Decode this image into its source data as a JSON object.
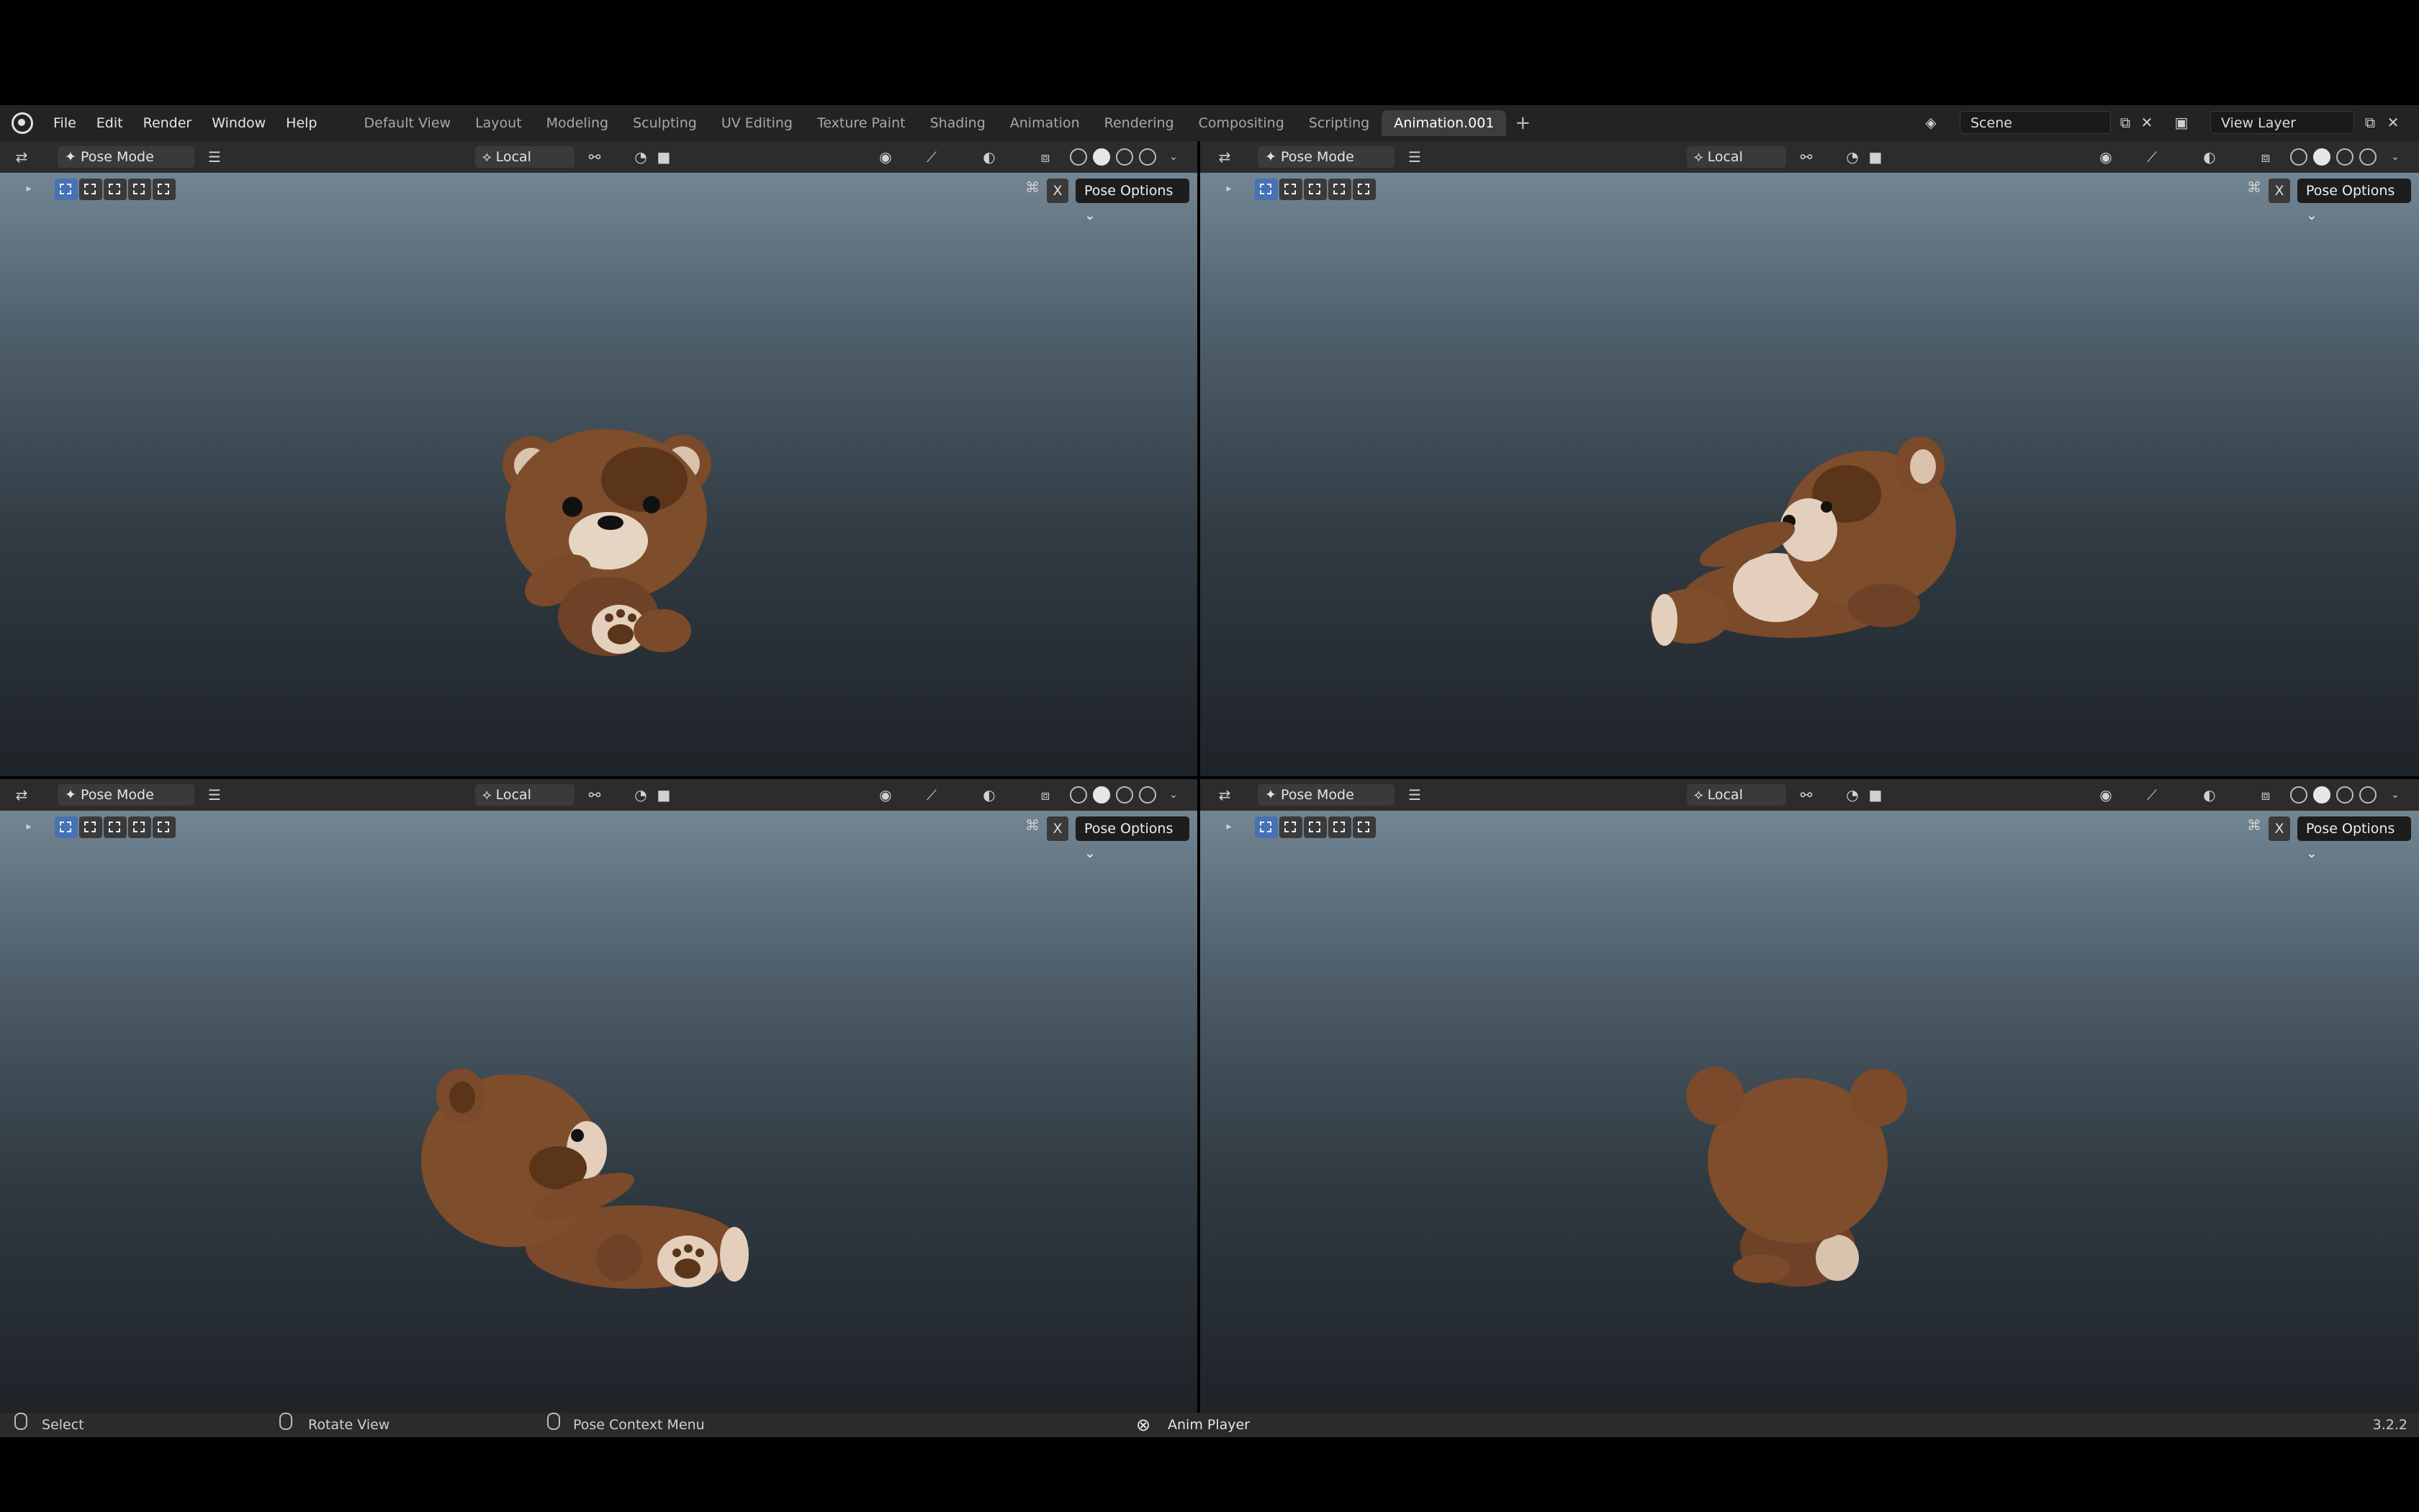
{
  "menu": [
    "File",
    "Edit",
    "Render",
    "Window",
    "Help"
  ],
  "workspaces": [
    "Default View",
    "Layout",
    "Modeling",
    "Sculpting",
    "UV Editing",
    "Texture Paint",
    "Shading",
    "Animation",
    "Rendering",
    "Compositing",
    "Scripting",
    "Animation.001"
  ],
  "active_workspace": "Animation.001",
  "scene": "Scene",
  "view_layer": "View Layer",
  "viewports": [
    {
      "mode": "Pose Mode",
      "orientation": "Local",
      "pose_options": "Pose Options",
      "x_label": "X"
    },
    {
      "mode": "Pose Mode",
      "orientation": "Local",
      "pose_options": "Pose Options",
      "x_label": "X"
    },
    {
      "mode": "Pose Mode",
      "orientation": "Local",
      "pose_options": "Pose Options",
      "x_label": "X"
    },
    {
      "mode": "Pose Mode",
      "orientation": "Local",
      "pose_options": "Pose Options",
      "x_label": "X"
    }
  ],
  "status": {
    "select": "Select",
    "rotate": "Rotate View",
    "context": "Pose Context Menu",
    "anim_player": "Anim Player",
    "version": "3.2.2"
  },
  "colors": {
    "accent": "#4772b3",
    "bear_fur": "#7a4a2a",
    "bear_light": "#d9c3ad"
  }
}
